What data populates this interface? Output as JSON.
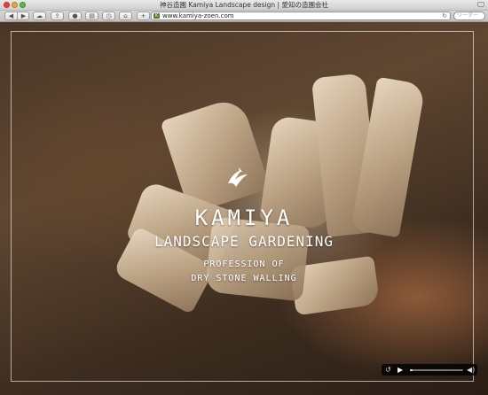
{
  "window": {
    "title": "神谷造園 Kamiya Landscape design | 愛知の造園会社"
  },
  "toolbar": {
    "back_glyph": "◀",
    "forward_glyph": "▶",
    "cloud_glyph": "☁",
    "share_glyph": "⇪",
    "stop_glyph": "●",
    "reader_glyph": "▤",
    "history_glyph": "◷",
    "home_glyph": "⌂",
    "plus_glyph": "+",
    "url": "www.kamiya-zoen.com",
    "reload_glyph": "↻",
    "search_placeholder": "リーダー",
    "favicon_glyph": "K"
  },
  "hero": {
    "name": "KAMIYA",
    "subtitle": "LANDSCAPE GARDENING",
    "tagline_line1": "PROFESSION OF",
    "tagline_line2": "DRY STONE WALLING"
  },
  "player": {
    "replay_glyph": "↺",
    "play_glyph": "▶",
    "volume_glyph": "◀)",
    "progress": 0.05
  },
  "colors": {
    "brand_text": "#ffffff",
    "favicon": "#557a2e"
  }
}
